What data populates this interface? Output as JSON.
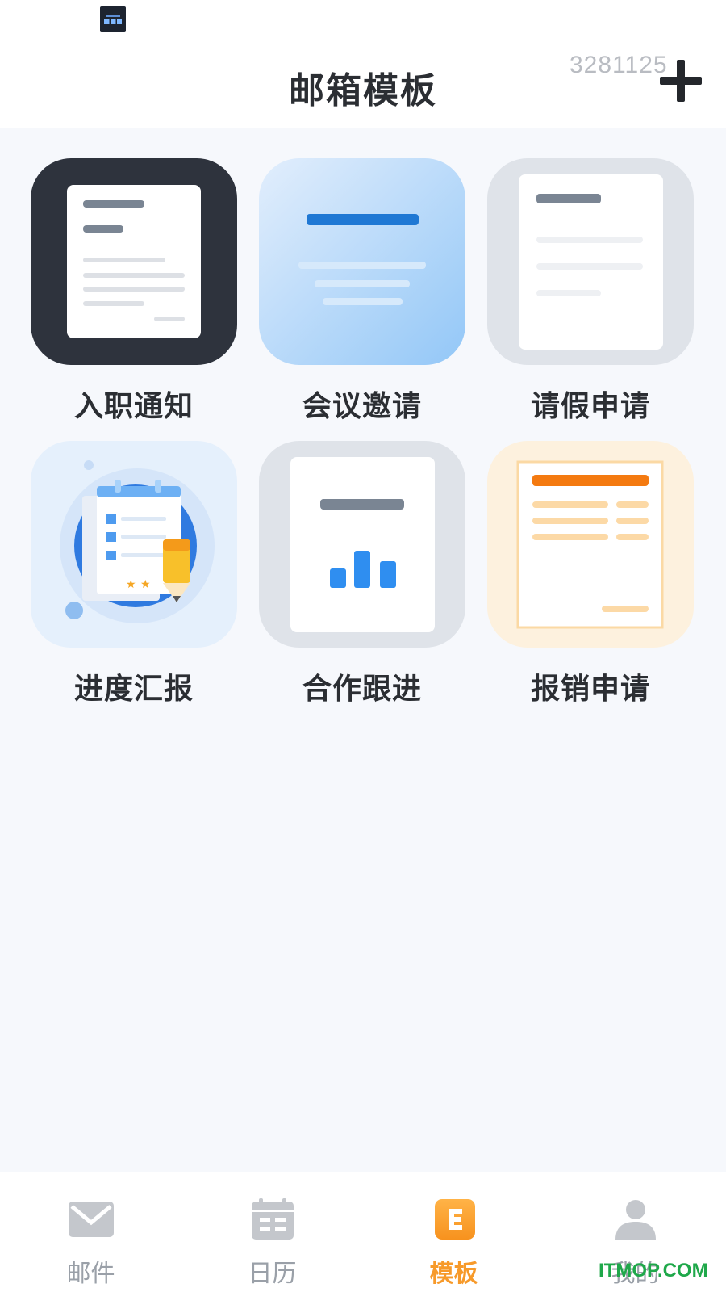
{
  "header": {
    "title": "邮箱模板",
    "id_text": "3281125",
    "add_icon": "plus-icon"
  },
  "templates": [
    {
      "label": "入职通知",
      "icon": "onboarding-document-icon"
    },
    {
      "label": "会议邀请",
      "icon": "meeting-invite-icon"
    },
    {
      "label": "请假申请",
      "icon": "leave-request-document-icon"
    },
    {
      "label": "进度汇报",
      "icon": "progress-report-notepad-icon"
    },
    {
      "label": "合作跟进",
      "icon": "bar-chart-document-icon"
    },
    {
      "label": "报销申请",
      "icon": "expense-form-icon"
    }
  ],
  "bottom_nav": {
    "items": [
      {
        "label": "邮件",
        "icon": "mail-icon",
        "active": false
      },
      {
        "label": "日历",
        "icon": "calendar-icon",
        "active": false
      },
      {
        "label": "模板",
        "icon": "template-e-icon",
        "active": true
      },
      {
        "label": "我的",
        "icon": "person-icon",
        "active": false
      }
    ]
  },
  "watermark": "ITMOP.COM",
  "colors": {
    "accent": "#f79a2a",
    "background": "#f6f8fc",
    "title": "#2b2e33",
    "inactive_nav": "#9aa0a8"
  }
}
